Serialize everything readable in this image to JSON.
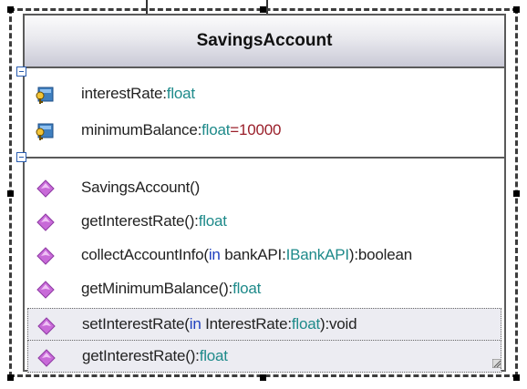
{
  "class": {
    "name": "SavingsAccount",
    "attributes": [
      {
        "name": "interestRate",
        "sep": ":",
        "type": "float",
        "default": ""
      },
      {
        "name": "minimumBalance",
        "sep": ":",
        "type": "float",
        "default": "=10000"
      }
    ],
    "operations": [
      {
        "pre": "SavingsAccount()",
        "kw": "",
        "mid": "",
        "type": "",
        "post": ""
      },
      {
        "pre": "getInterestRate():",
        "kw": "",
        "mid": "",
        "type": "float",
        "post": ""
      },
      {
        "pre": "collectAccountInfo(",
        "kw": "in",
        "mid": " bankAPI:",
        "type": "IBankAPI",
        "post": "):boolean"
      },
      {
        "pre": "getMinimumBalance():",
        "kw": "",
        "mid": "",
        "type": "float",
        "post": ""
      },
      {
        "pre": "setInterestRate(",
        "kw": "in",
        "mid": " InterestRate:",
        "type": "float",
        "post": "):void"
      },
      {
        "pre": "getInterestRate():",
        "kw": "",
        "mid": "",
        "type": "float",
        "post": ""
      }
    ]
  },
  "colors": {
    "keyword": "#1f3fbf",
    "type": "#1e8a8a",
    "default_value": "#9a1f2a",
    "operation_icon": "#c86ad8"
  }
}
